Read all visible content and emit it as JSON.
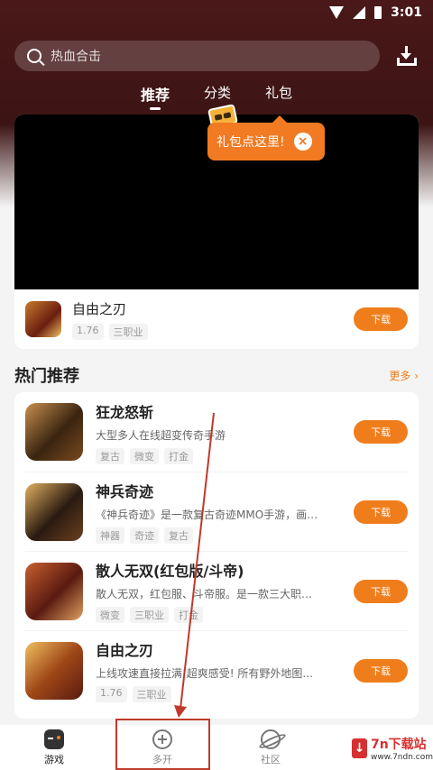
{
  "status": {
    "time": "3:01"
  },
  "search": {
    "placeholder": "热血合击"
  },
  "tabs": [
    {
      "label": "推荐"
    },
    {
      "label": "分类"
    },
    {
      "label": "礼包"
    }
  ],
  "popover": {
    "text": "礼包点这里!",
    "close": "×"
  },
  "hero": {
    "title": "自由之刃",
    "tags": [
      "1.76",
      "三职业"
    ],
    "download": "下载"
  },
  "section": {
    "title": "热门推荐",
    "more": "更多 ›"
  },
  "games": [
    {
      "title": "狂龙怒斩",
      "desc": "大型多人在线超变传奇手游",
      "tags": [
        "复古",
        "微变",
        "打金"
      ],
      "download": "下载",
      "thumb_color": "#5a3a20"
    },
    {
      "title": "神兵奇迹",
      "desc": "《神兵奇迹》是一款复古奇迹MMO手游，画面...",
      "tags": [
        "神器",
        "奇迹",
        "复古"
      ],
      "download": "下载",
      "thumb_color": "#3a2a1a"
    },
    {
      "title": "散人无双(红包版/斗帝)",
      "desc": "散人无双，红包服、斗帝服。是一款三大职业...",
      "tags": [
        "微变",
        "三职业",
        "打金"
      ],
      "download": "下载",
      "thumb_color": "#7a2818"
    },
    {
      "title": "自由之刃",
      "desc": "上线攻速直接拉满!超爽感受! 所有野外地图...",
      "tags": [
        "1.76",
        "三职业"
      ],
      "download": "下载",
      "thumb_color": "#a8501c"
    }
  ],
  "nav": [
    {
      "label": "游戏",
      "icon": "gamepad-icon"
    },
    {
      "label": "多开",
      "icon": "plus-circle-icon"
    },
    {
      "label": "社区",
      "icon": "planet-icon"
    },
    {
      "label": "",
      "icon": "user-icon"
    }
  ],
  "badge": {
    "title": "7n下载站",
    "url": "www.7ndn.com"
  },
  "colors": {
    "accent": "#f07d1c",
    "header": "#4a1818",
    "highlight_box": "#c0392b"
  }
}
